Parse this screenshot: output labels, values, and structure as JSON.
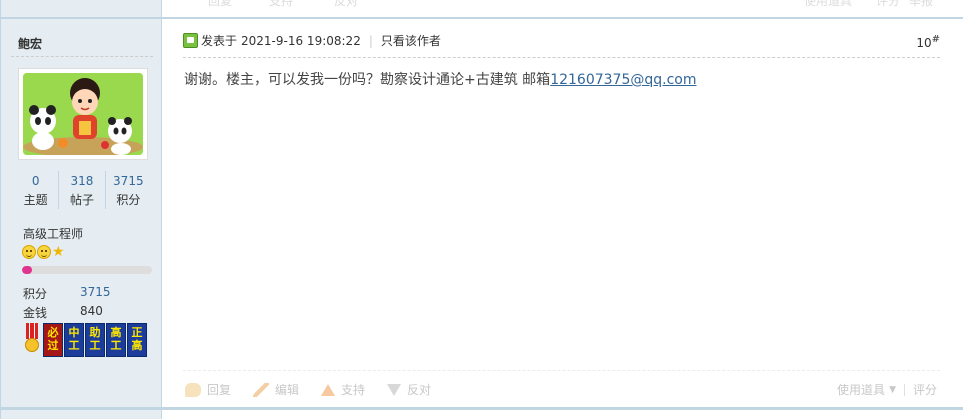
{
  "prev_post": {
    "actions_faded": [
      "回复",
      "支持",
      "反对"
    ],
    "right_faded": [
      "使用道具",
      "评分",
      "举报"
    ]
  },
  "author": {
    "name": "鲍宏",
    "stats": [
      {
        "value": "0",
        "label": "主题"
      },
      {
        "value": "318",
        "label": "帖子"
      },
      {
        "value": "3715",
        "label": "积分"
      }
    ],
    "rank_title": "高级工程师",
    "progress_fraction": 0.08,
    "points_label": "积分",
    "points_value": "3715",
    "money_label": "金钱",
    "money_value": "840",
    "medals": [
      "必过",
      "中工",
      "助工",
      "高工",
      "正高"
    ]
  },
  "post": {
    "posted_prefix": "发表于",
    "posted_time": "2021-9-16 19:08:22",
    "sep": "|",
    "only_author": "只看该作者",
    "floor_number": "10",
    "floor_mark": "#",
    "content_text": "谢谢。楼主，可以发我一份吗？勘察设计通论+古建筑  邮箱",
    "content_email": "121607375@qq.com"
  },
  "footer": {
    "reply": "回复",
    "edit": "编辑",
    "support": "支持",
    "oppose": "反对",
    "use_item": "使用道具",
    "rate": "评分"
  },
  "colors": {
    "sidebar_bg": "#e5edf2",
    "border": "#c2d5e3",
    "link": "#336699",
    "progress": "#e1348e"
  }
}
